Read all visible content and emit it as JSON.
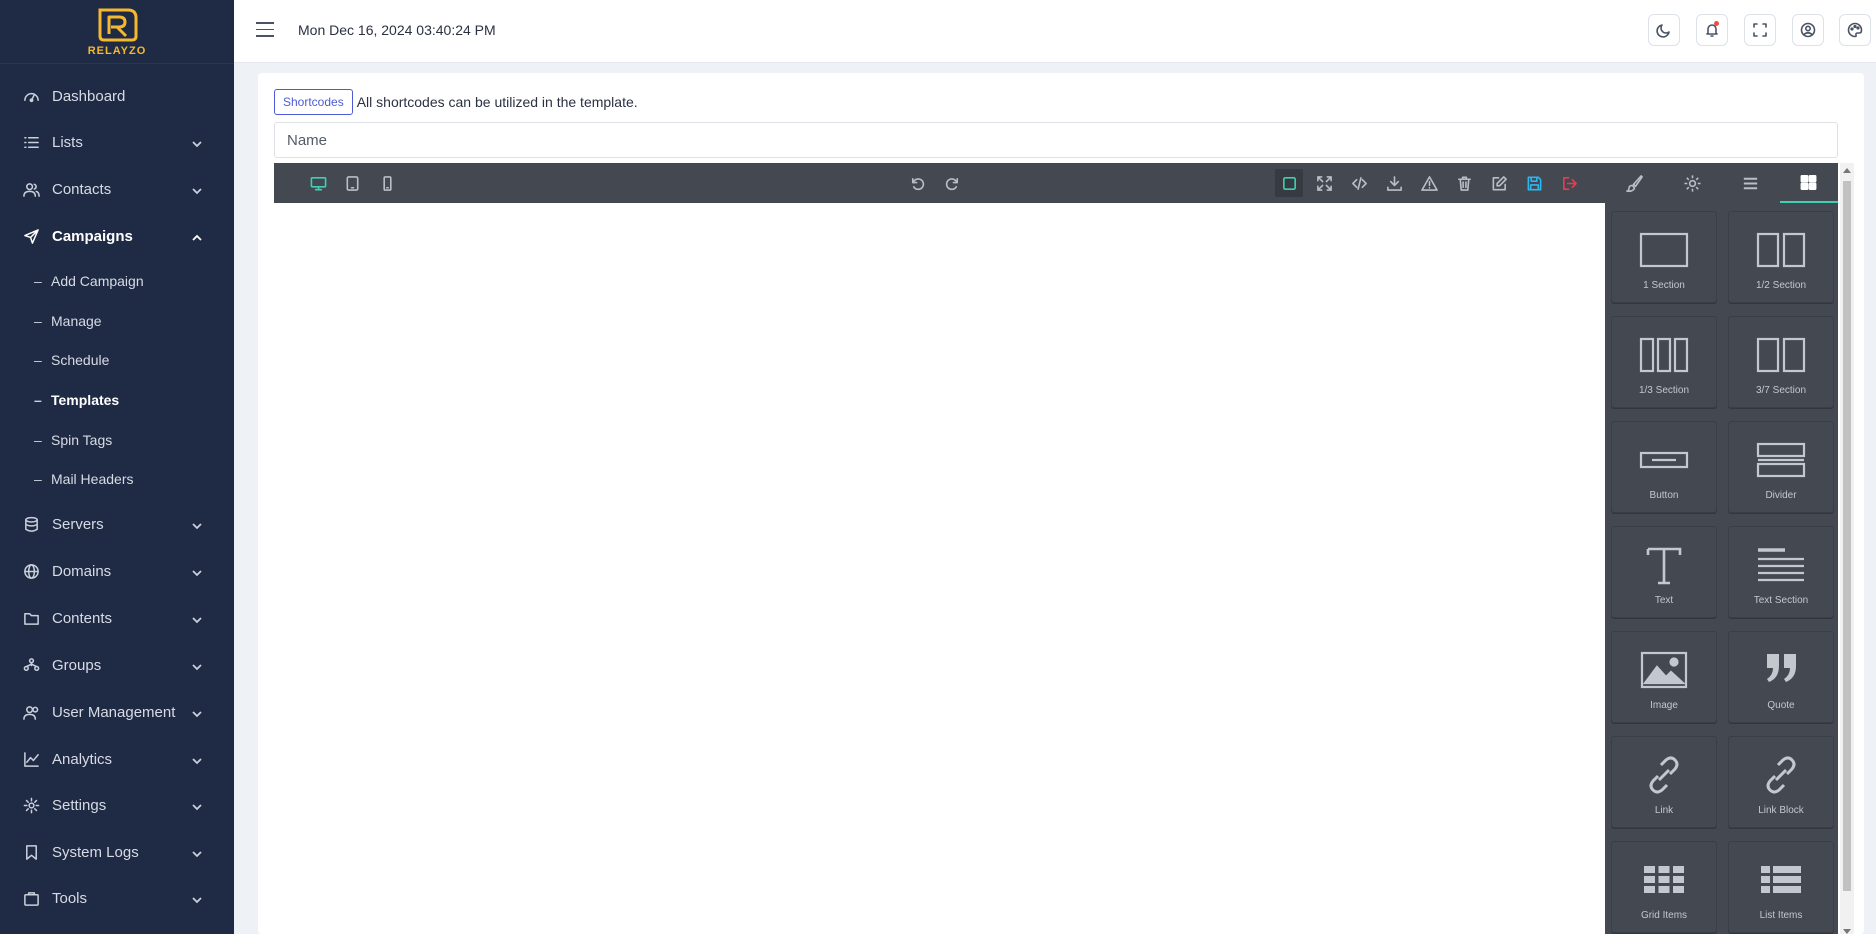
{
  "brand": {
    "name": "RELAYZO",
    "logo_color": "#f5b82e"
  },
  "sidebar": {
    "items": [
      {
        "label": "Dashboard",
        "icon": "dashboard-icon"
      },
      {
        "label": "Lists",
        "icon": "list-icon"
      },
      {
        "label": "Contacts",
        "icon": "users-icon"
      },
      {
        "label": "Campaigns",
        "icon": "send-icon"
      },
      {
        "label": "Servers",
        "icon": "database-icon"
      },
      {
        "label": "Domains",
        "icon": "globe-icon"
      },
      {
        "label": "Contents",
        "icon": "folder-icon"
      },
      {
        "label": "Groups",
        "icon": "groups-icon"
      },
      {
        "label": "User Management",
        "icon": "user-management-icon"
      },
      {
        "label": "Analytics",
        "icon": "analytics-icon"
      },
      {
        "label": "Settings",
        "icon": "gear-icon"
      },
      {
        "label": "System Logs",
        "icon": "bookmark-icon"
      },
      {
        "label": "Tools",
        "icon": "briefcase-icon"
      }
    ],
    "campaign_sub": [
      {
        "label": "Add Campaign"
      },
      {
        "label": "Manage"
      },
      {
        "label": "Schedule"
      },
      {
        "label": "Templates"
      },
      {
        "label": "Spin Tags"
      },
      {
        "label": "Mail Headers"
      }
    ],
    "active_item": "Campaigns",
    "active_sub": "Templates"
  },
  "topbar": {
    "datetime": "Mon Dec 16, 2024 03:40:24 PM"
  },
  "main": {
    "shortcodes_label": "Shortcodes",
    "shortcodes_text": "All shortcodes can be utilized in the template.",
    "name_placeholder": "Name"
  },
  "editor": {
    "accent_color": "#3fd0b4",
    "blocks": [
      {
        "label": "1 Section"
      },
      {
        "label": "1/2 Section"
      },
      {
        "label": "1/3 Section"
      },
      {
        "label": "3/7 Section"
      },
      {
        "label": "Button"
      },
      {
        "label": "Divider"
      },
      {
        "label": "Text"
      },
      {
        "label": "Text Section"
      },
      {
        "label": "Image"
      },
      {
        "label": "Quote"
      },
      {
        "label": "Link"
      },
      {
        "label": "Link Block"
      },
      {
        "label": "Grid Items"
      },
      {
        "label": "List Items"
      }
    ]
  }
}
